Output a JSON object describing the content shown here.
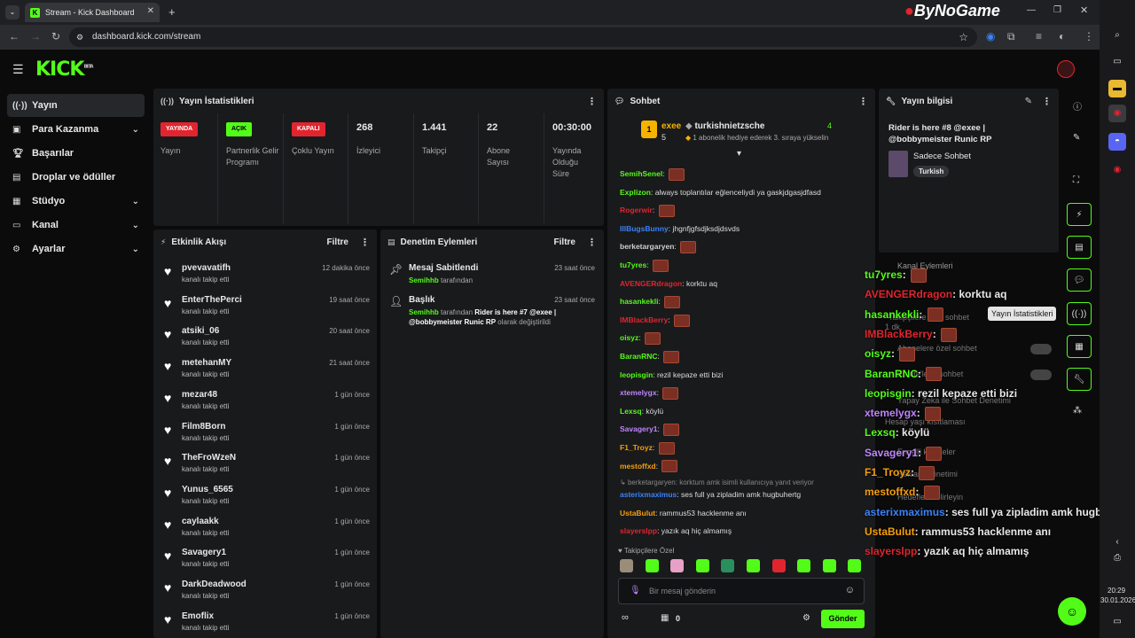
{
  "browser": {
    "tab_title": "Stream - Kick Dashboard",
    "url": "dashboard.kick.com/stream",
    "watermark": "ByNoGame"
  },
  "brand": {
    "logo": "KICK",
    "beta": "BETA"
  },
  "sidebar": {
    "items": [
      {
        "label": "Yayın",
        "icon": "broadcast-icon",
        "chevron": false
      },
      {
        "label": "Para Kazanma",
        "icon": "money-icon",
        "chevron": true
      },
      {
        "label": "Başarılar",
        "icon": "trophy-icon",
        "chevron": false
      },
      {
        "label": "Droplar ve ödüller",
        "icon": "gift-icon",
        "chevron": false
      },
      {
        "label": "Stüdyo",
        "icon": "studio-icon",
        "chevron": true
      },
      {
        "label": "Kanal",
        "icon": "channel-icon",
        "chevron": true
      },
      {
        "label": "Ayarlar",
        "icon": "gear-icon",
        "chevron": true
      }
    ]
  },
  "stats": {
    "title": "Yayın İstatistikleri",
    "items": [
      {
        "badge": "YAYINDA",
        "label": "Yayın"
      },
      {
        "badge": "AÇIK",
        "label": "Partnerlik Gelir Programı"
      },
      {
        "badge": "KAPALI",
        "label": "Çoklu Yayın"
      },
      {
        "value": "268",
        "label": "İzleyici"
      },
      {
        "value": "1.441",
        "label": "Takipçi"
      },
      {
        "value": "22",
        "label": "Abone Sayısı"
      },
      {
        "value": "00:30:00",
        "label": "Yayında Olduğu Süre"
      }
    ]
  },
  "activity": {
    "title": "Etkinlik Akışı",
    "filter": "Filtre",
    "rows": [
      {
        "name": "pvevavatifh",
        "action": "kanalı takip etti",
        "time": "12 dakika önce"
      },
      {
        "name": "EnterThePerci",
        "action": "kanalı takip etti",
        "time": "19 saat önce"
      },
      {
        "name": "atsiki_06",
        "action": "kanalı takip etti",
        "time": "20 saat önce"
      },
      {
        "name": "metehanMY",
        "action": "kanalı takip etti",
        "time": "21 saat önce"
      },
      {
        "name": "mezar48",
        "action": "kanalı takip etti",
        "time": "1 gün önce"
      },
      {
        "name": "Film8Born",
        "action": "kanalı takip etti",
        "time": "1 gün önce"
      },
      {
        "name": "TheFroWzeN",
        "action": "kanalı takip etti",
        "time": "1 gün önce"
      },
      {
        "name": "Yunus_6565",
        "action": "kanalı takip etti",
        "time": "1 gün önce"
      },
      {
        "name": "caylaakk",
        "action": "kanalı takip etti",
        "time": "1 gün önce"
      },
      {
        "name": "Savagery1",
        "action": "kanalı takip etti",
        "time": "1 gün önce"
      },
      {
        "name": "DarkDeadwood",
        "action": "kanalı takip etti",
        "time": "1 gün önce"
      },
      {
        "name": "Emoflix",
        "action": "kanalı takip etti",
        "time": "1 gün önce"
      }
    ]
  },
  "moderation": {
    "title": "Denetim Eylemleri",
    "filter": "Filtre",
    "rows": [
      {
        "title": "Mesaj Sabitlendi",
        "time": "23 saat önce",
        "user": "Semihhb",
        "suffix": "tarafından"
      },
      {
        "title": "Başlık",
        "time": "23 saat önce",
        "user": "Semihhb",
        "middle": "tarafından",
        "quote": "Rider is here #7 @exee | @bobbymeister Runic RP",
        "suffix": "olarak değiştirildi"
      }
    ]
  },
  "chat": {
    "title": "Sohbet",
    "top_gifter": "exee",
    "top_gifter_count": "5",
    "gift_user": "turkishnietzsche",
    "gift_count": "4",
    "gift_text": "1 abonelik hediye ederek 3. sıraya yükselin",
    "messages": [
      {
        "user": "SemihSenel",
        "color": "#53fc18",
        "text": ""
      },
      {
        "user": "Explizon",
        "color": "#53fc18",
        "text": "always toplantılar eğlenceliydi ya gaskjdgasjdfasd"
      },
      {
        "user": "Rogerwir",
        "color": "#e1252f",
        "text": ""
      },
      {
        "user": "IllBugsBunny",
        "color": "#3b82f6",
        "text": "jhgnfjgfsdjksdjdsvds"
      },
      {
        "user": "berketargaryen",
        "color": "#cfcfcf",
        "text": ""
      },
      {
        "user": "tu7yres",
        "color": "#53fc18",
        "text": ""
      },
      {
        "user": "AVENGERdragon",
        "color": "#e1252f",
        "text": "korktu aq"
      },
      {
        "user": "hasankekli",
        "color": "#53fc18",
        "text": ""
      },
      {
        "user": "IMBlackBerry",
        "color": "#e1252f",
        "text": ""
      },
      {
        "user": "oisyz",
        "color": "#53fc18",
        "text": ""
      },
      {
        "user": "BaranRNC",
        "color": "#53fc18",
        "text": ""
      },
      {
        "user": "leopisgin",
        "color": "#53fc18",
        "text": "rezil kepaze etti bizi"
      },
      {
        "user": "xtemelygx",
        "color": "#c084fc",
        "text": ""
      },
      {
        "user": "Lexsq",
        "color": "#53fc18",
        "text": "köylü"
      },
      {
        "user": "Savagery1",
        "color": "#c084fc",
        "text": ""
      },
      {
        "user": "F1_Troyz",
        "color": "#f59e0b",
        "text": ""
      },
      {
        "user": "mestoffxd",
        "color": "#f59e0b",
        "text": ""
      }
    ],
    "reply_hint": "berketargaryen: korktum amk isimli kullanıcıya yanıt veriyor",
    "messages2": [
      {
        "user": "asterixmaximus",
        "color": "#3b82f6",
        "text": "ses full ya zipladim amk hugbuhertg"
      },
      {
        "user": "UstaBulut",
        "color": "#f59e0b",
        "text": "rammus53 hacklenme anı"
      },
      {
        "user": "slayerslpp",
        "color": "#e1252f",
        "text": "yazık aq hiç almamış"
      }
    ],
    "emote_section": "Takipçilere Özel",
    "input_placeholder": "Bir mesaj gönderin",
    "points": "0",
    "send_label": "Gönder"
  },
  "stream_info": {
    "title": "Yayın bilgisi",
    "stream_title": "Rider is here #8 @exee | @bobbymeister Runic RP",
    "category": "Sadece Sohbet",
    "tag": "Turkish"
  },
  "overlay_chat": [
    {
      "user": "tu7yres",
      "color": "#53fc18",
      "text": ""
    },
    {
      "user": "AVENGERdragon",
      "color": "#e1252f",
      "text": "korktu aq"
    },
    {
      "user": "hasankekli",
      "color": "#53fc18",
      "text": ""
    },
    {
      "user": "IMBlackBerry",
      "color": "#e1252f",
      "text": ""
    },
    {
      "user": "oisyz",
      "color": "#53fc18",
      "text": ""
    },
    {
      "user": "BaranRNC",
      "color": "#53fc18",
      "text": ""
    },
    {
      "user": "leopisgin",
      "color": "#53fc18",
      "text": "rezil kepaze etti bizi"
    },
    {
      "user": "xtemelygx",
      "color": "#c084fc",
      "text": ""
    },
    {
      "user": "Lexsq",
      "color": "#53fc18",
      "text": "köylü"
    },
    {
      "user": "Savagery1",
      "color": "#c084fc",
      "text": ""
    },
    {
      "user": "F1_Troyz",
      "color": "#f59e0b",
      "text": ""
    },
    {
      "user": "mestoffxd",
      "color": "#f59e0b",
      "text": ""
    },
    {
      "user": "asterixmaximus",
      "color": "#3b82f6",
      "text": "ses full ya zipladim amk hugbuher"
    },
    {
      "user": "UstaBulut",
      "color": "#f59e0b",
      "text": "rammus53 hacklenme anı"
    },
    {
      "user": "slayerslpp",
      "color": "#e1252f",
      "text": "yazık aq hiç almamış"
    }
  ],
  "overlay_bg": {
    "kanal_eylemleri": "Kanal Eylemleri",
    "row1": "Takipçilere özel sohbet",
    "row1_extra": "1 dk.",
    "row2": "Abonelere özel sohbet",
    "row3": "Emote'lerle sohbet",
    "row4": "Yapay Zeka ile Sohbet Denetimi",
    "row5": "Hesap yaşı kısıtlaması",
    "row6": "Engelli kelimeler",
    "row7": "Reklam Yönetimi",
    "row8": "Hedefleri belirleyin"
  },
  "tooltip": "Yayın İstatistikleri",
  "taskbar": {
    "time": "20:29",
    "date": "30.01.2026"
  }
}
